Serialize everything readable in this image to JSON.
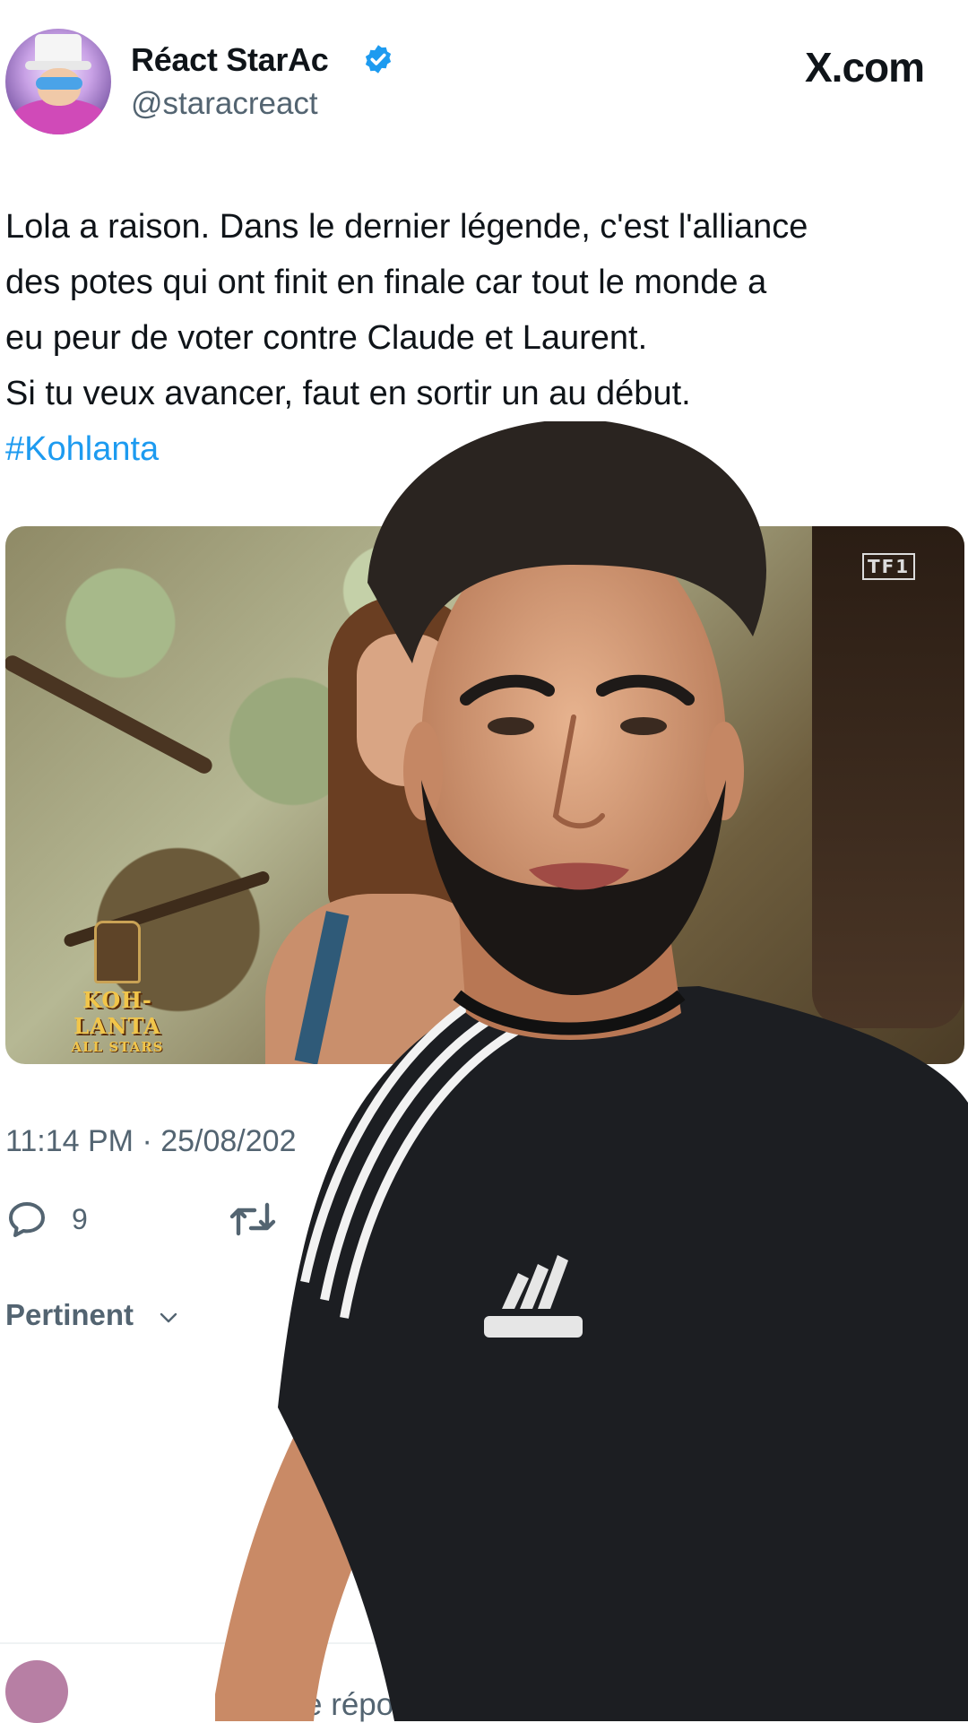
{
  "header": {
    "display_name": "Réact StarAc",
    "handle": "@staracreact",
    "site_logo": "X.com",
    "verified_color": "#1d9bf0"
  },
  "tweet": {
    "lines": [
      "Lola a raison. Dans le dernier légende, c'est l'alliance",
      "des potes qui ont finit en finale car tout le monde a",
      "eu peur de voter contre Claude et Laurent.",
      "Si tu veux avancer, faut en sortir un au début."
    ],
    "hashtag": "#Kohlanta",
    "hashtag_color": "#1d9bf0"
  },
  "media": {
    "channel_logo": "TF1",
    "show_title": "KOH-LANTA",
    "show_subtitle": "ALL STARS"
  },
  "meta": {
    "timestamp": "11:14 PM · 25/08/202",
    "reply_count": "9",
    "sort_label": "Pertinent",
    "reply_placeholder": "e répons"
  },
  "icons": [
    "verified-badge-icon",
    "reply-icon",
    "retweet-icon",
    "chevron-down-icon"
  ]
}
